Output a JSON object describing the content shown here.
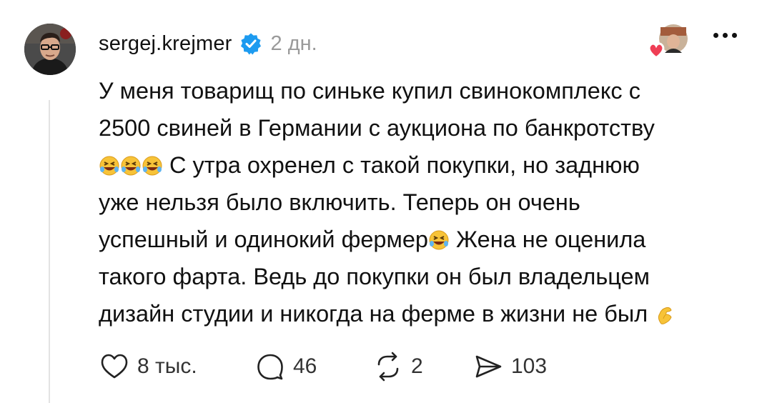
{
  "post": {
    "username": "sergej.krejmer",
    "time_ago": "2 дн.",
    "lines": [
      "У меня товарищ по синьке купил свинокомплекс с",
      "2500 свиней в Германии с аукциона по банкротству",
      "С утра охренел с такой покупки, но заднюю",
      "уже нельзя было включить. Теперь он очень",
      "успешный и одинокий фермер",
      "Жена не оценила",
      "такого фарта. Ведь до покупки он был владельцем",
      "дизайн студии и никогда на ферме в жизни не был"
    ],
    "emoji_names": [
      "rolling-on-floor-laughing",
      "pinching-hand"
    ]
  },
  "actions": {
    "likes": "8 тыс.",
    "comments": "46",
    "reposts": "2",
    "shares": "103"
  },
  "colors": {
    "text": "#111111",
    "muted": "#9a9a9a",
    "verified": "#1d9bf0",
    "heart": "#ef3e55",
    "emoji_yellow": "#f7c338"
  }
}
